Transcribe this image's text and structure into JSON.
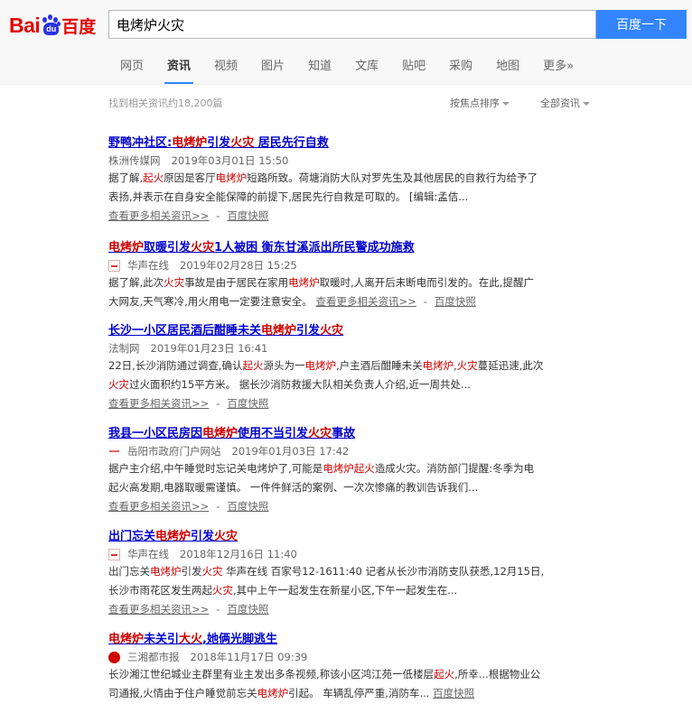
{
  "logo": {
    "bai": "Bai",
    "du": "du",
    "cn": "百度"
  },
  "search": {
    "query": "电烤炉火灾",
    "button": "百度一下"
  },
  "nav": [
    {
      "label": "网页",
      "active": false
    },
    {
      "label": "资讯",
      "active": true
    },
    {
      "label": "视频",
      "active": false
    },
    {
      "label": "图片",
      "active": false
    },
    {
      "label": "知道",
      "active": false
    },
    {
      "label": "文库",
      "active": false
    },
    {
      "label": "贴吧",
      "active": false
    },
    {
      "label": "采购",
      "active": false
    },
    {
      "label": "地图",
      "active": false
    },
    {
      "label": "更多»",
      "active": false
    }
  ],
  "meta": {
    "count": "找到相关资讯约18,200篇",
    "sort": "按焦点排序",
    "filter": "全部资讯"
  },
  "labels": {
    "more": "查看更多相关资讯>>",
    "sep": "-",
    "snapshot": "百度快照"
  },
  "colors": {
    "accent": "#3385ff",
    "brand_red": "#e10601",
    "link": "#0000cc",
    "highlight": "#cc0000"
  },
  "results": [
    {
      "title": [
        [
          "野鸭冲社区:",
          false
        ],
        [
          "电烤炉",
          true
        ],
        [
          "引发",
          false
        ],
        [
          "火灾",
          true
        ],
        [
          " 居民先行自救",
          false
        ]
      ],
      "source": "株洲传媒网",
      "favicon": "",
      "date": "2019年03月01日 15:50",
      "lines": [
        [
          [
            "据了解,",
            false
          ],
          [
            "起火",
            true
          ],
          [
            "原因是客厅",
            false
          ],
          [
            "电烤炉",
            true
          ],
          [
            "短路所致。荷塘消防大队对罗先生及其他居民的自救行为给予了",
            false
          ]
        ],
        [
          [
            "表扬,并表示在自身安全能保障的前提下,居民先行自救是可取的。 [编辑:孟佶...",
            false
          ]
        ]
      ],
      "inline_more": false
    },
    {
      "title": [
        [
          "电烤炉",
          true
        ],
        [
          "取暖引发",
          false
        ],
        [
          "火灾",
          true
        ],
        [
          "1人被困 衡东甘溪派出所民警成功施救",
          false
        ]
      ],
      "source": "华声在线",
      "favicon": "hs",
      "date": "2019年02月28日 15:25",
      "lines": [
        [
          [
            "据了解,此次",
            false
          ],
          [
            "火灾",
            true
          ],
          [
            "事故是由于居民在家用",
            false
          ],
          [
            "电烤炉",
            true
          ],
          [
            "取暖时,人离开后未断电而引发的。在此,提醒广",
            false
          ]
        ],
        [
          [
            "大网友,天气寒冷,用火用电一定要注意安全。",
            false
          ]
        ]
      ],
      "inline_more": true
    },
    {
      "title": [
        [
          "长沙一小区居民酒后酣睡未关",
          false
        ],
        [
          "电烤炉",
          true
        ],
        [
          "引发",
          false
        ],
        [
          "火灾",
          true
        ]
      ],
      "source": "法制网",
      "favicon": "",
      "date": "2019年01月23日 16:41",
      "lines": [
        [
          [
            "22日,长沙消防通过调查,确认",
            false
          ],
          [
            "起火",
            true
          ],
          [
            "源头为一",
            false
          ],
          [
            "电烤炉",
            true
          ],
          [
            ",户主酒后酣睡未关",
            false
          ],
          [
            "电烤炉",
            true
          ],
          [
            ",",
            false
          ],
          [
            "火灾",
            true
          ],
          [
            "蔓延迅速,此次",
            false
          ]
        ],
        [
          [
            "火灾",
            true
          ],
          [
            "过火面积约15平方米。 据长沙消防救援大队相关负责人介绍,近一周共处...",
            false
          ]
        ]
      ],
      "inline_more": false
    },
    {
      "title": [
        [
          "我县一小区民房因",
          false
        ],
        [
          "电烤炉",
          true
        ],
        [
          "使用不当引发",
          false
        ],
        [
          "火灾",
          true
        ],
        [
          "事故",
          false
        ]
      ],
      "source": "岳阳市政府门户网站",
      "favicon": "gov",
      "date": "2019年01月03日 17:42",
      "lines": [
        [
          [
            "据户主介绍,中午睡觉时忘记关电烤炉了,可能是",
            false
          ],
          [
            "电烤炉起火",
            true
          ],
          [
            "造成火灾。消防部门提醒:冬季为电",
            false
          ]
        ],
        [
          [
            "起火高发期,电器取暖需谨慎。 一件件鲜活的案例、一次次惨痛的教训告诉我们...",
            false
          ]
        ]
      ],
      "inline_more": false
    },
    {
      "title": [
        [
          "出门忘关",
          false
        ],
        [
          "电烤炉",
          true
        ],
        [
          "引发",
          false
        ],
        [
          "火灾",
          true
        ]
      ],
      "source": "华声在线",
      "favicon": "hs",
      "date": "2018年12月16日 11:40",
      "lines": [
        [
          [
            "出门忘关",
            false
          ],
          [
            "电烤炉",
            true
          ],
          [
            "引发",
            false
          ],
          [
            "火灾",
            true
          ],
          [
            " 华声在线 百家号12-1611:40 记者从长沙市消防支队获悉,12月15日,",
            false
          ]
        ],
        [
          [
            "长沙市雨花区发生两起",
            false
          ],
          [
            "火灾",
            true
          ],
          [
            ",其中上午一起发生在新星小区,下午一起发生在...",
            false
          ]
        ]
      ],
      "inline_more": false
    },
    {
      "title": [
        [
          "电烤炉",
          true
        ],
        [
          "未关引",
          false
        ],
        [
          "大火",
          true
        ],
        [
          ",她俩光脚逃生",
          false
        ]
      ],
      "source": "三湘都市报",
      "favicon": "sx",
      "date": "2018年11月17日 09:39",
      "lines": [
        [
          [
            "长沙湘江世纪城业主群里有业主发出多条视频,称该小区鸿江苑一低楼层",
            false
          ],
          [
            "起火",
            true
          ],
          [
            ",所幸...根据物业公",
            false
          ]
        ],
        [
          [
            "司通报,火情由于住户睡觉前忘关",
            false
          ],
          [
            "电烤炉",
            true
          ],
          [
            "引起。 车辆乱停严重,消防车...",
            false
          ]
        ]
      ],
      "inline_more": true,
      "snapshot_only": true
    }
  ]
}
